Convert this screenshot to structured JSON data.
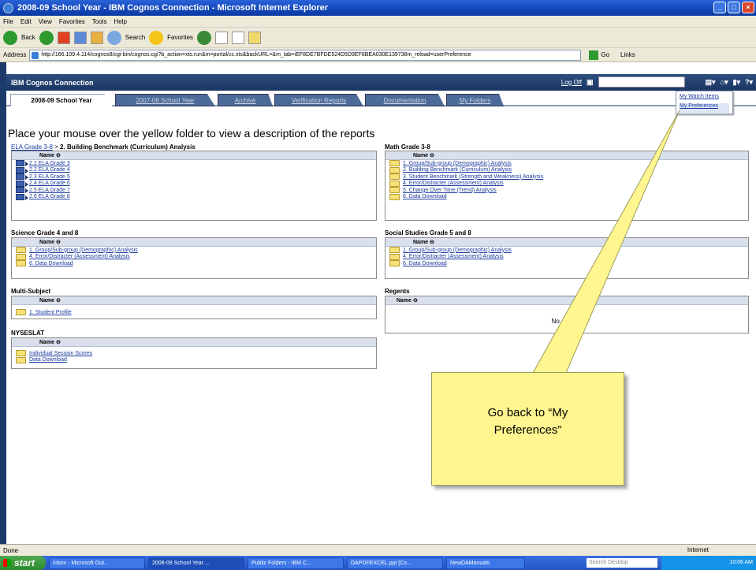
{
  "window": {
    "title": "2008-09 School Year - IBM Cognos Connection - Microsoft Internet Explorer"
  },
  "menubar": [
    "File",
    "Edit",
    "View",
    "Favorites",
    "Tools",
    "Help"
  ],
  "toolbar": {
    "back": "Back",
    "search": "Search",
    "favorites": "Favorites"
  },
  "addressbar": {
    "label": "Address",
    "url": "http://166.109.4.114/cognos8/cgi-bin/cognos.cgi?b_action=xts.run&m=portal/cc.xts&backURL=&m_tab=iEF8DE7BFDE524D5D9EF8BEA030E139738m_reload=userPreference",
    "go": "Go",
    "links": "Links"
  },
  "cognos": {
    "app_title": "IBM Cognos Connection",
    "logoff": "Log Off",
    "tabs": [
      "2008-09 School Year",
      "2007-08 School Year",
      "Archive",
      "Verification Reports",
      "Documentation",
      "My Folders"
    ],
    "dropdown": [
      "My Watch Items",
      "My Preferences"
    ]
  },
  "page": {
    "heading": "Place your mouse over the yellow folder to view a description of the reports",
    "breadcrumb_link": "ELA Grade 3-8",
    "breadcrumb_sep": " > ",
    "breadcrumb_current": "2. Building Benchmark (Curriculum) Analysis",
    "name_header": "Name ⊖"
  },
  "panels": {
    "ela": {
      "items": [
        "2.1 ELA Grade 3",
        "2.2 ELA Grade 4",
        "2.3 ELA Grade 5",
        "2.4 ELA Grade 6",
        "2.5 ELA Grade 7",
        "2.6 ELA Grade 8"
      ]
    },
    "math": {
      "title": "Math Grade 3-8",
      "items": [
        "1. Group/Sub-group (Demographic) Analysis",
        "2. Building Benchmark (Curriculum) Analysis",
        "3. Student Benchmark (Strength and Weakness) Analysis",
        "4. Error/Distracter (Assessment) Analysis",
        "5. Change Over Time (Trend) Analysis",
        "6. Data Download"
      ]
    },
    "science": {
      "title": "Science Grade 4 and 8",
      "items": [
        "1. Group/Sub-group (Demographic) Analysis",
        "4. Error/Distracter (Assessment) Analysis",
        "6. Data Download"
      ]
    },
    "social": {
      "title": "Social Studies Grade 5 and 8",
      "items": [
        "1. Group/Sub-group (Demographic) Analysis",
        "4. Error/Distracter (Assessment) Analysis",
        "6. Data Download"
      ]
    },
    "multi": {
      "title": "Multi-Subject",
      "items": [
        "1. Student Profile"
      ]
    },
    "regents": {
      "title": "Regents",
      "empty": "No entries."
    },
    "nyseslat": {
      "title": "NYSESLAT",
      "items": [
        "Individual Session Scores",
        "Data Download"
      ]
    }
  },
  "callout": {
    "line1": "Go back to “My",
    "line2": "Preferences”"
  },
  "statusbar": {
    "left": "Done",
    "right": "Internet"
  },
  "taskbar": {
    "start": "start",
    "tasks": [
      "Inbox - Microsoft Out...",
      "2008-09 School Year ...",
      "Public Folders - IBM C...",
      "DAPDFEXCEL.ppt [Co...",
      "NewDAManuals"
    ],
    "search": "Search Desktop",
    "time": "10:06 AM"
  }
}
